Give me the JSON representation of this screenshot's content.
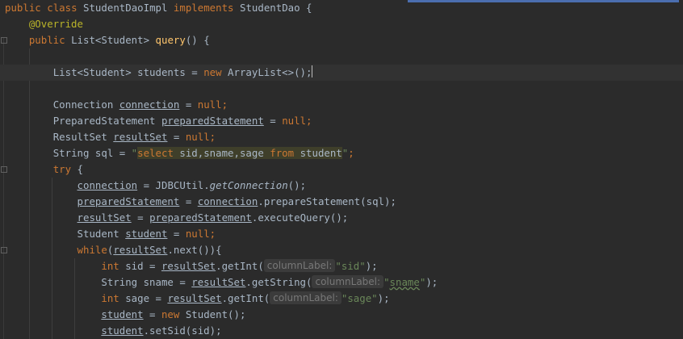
{
  "code": {
    "l1": {
      "kw1": "public",
      "kw2": "class",
      "cls": "StudentDaoImpl",
      "kw3": "implements",
      "iface": "StudentDao {"
    },
    "l2": {
      "ann": "@Override"
    },
    "l3": {
      "kw1": "public",
      "type": "List<Student>",
      "method": "query",
      "rest": "() {"
    },
    "l5": {
      "type": "List<Student> students = ",
      "kw": "new",
      "rest": " ArrayList<>();"
    },
    "l7": {
      "type": "Connection ",
      "var": "connection",
      "eq": " = ",
      "kw": "null",
      "end": ";"
    },
    "l8": {
      "type": "PreparedStatement ",
      "var": "preparedStatement",
      "eq": " = ",
      "kw": "null",
      "end": ";"
    },
    "l9": {
      "type": "ResultSet ",
      "var": "resultSet",
      "eq": " = ",
      "kw": "null",
      "end": ";"
    },
    "l10": {
      "type": "String sql = ",
      "q1": "\"",
      "sql1": "select",
      "sql2": " sid,sname,sage ",
      "sql3": "from",
      "sql4": " student",
      "q2": "\"",
      "end": ";"
    },
    "l11": {
      "kw": "try",
      "rest": " {"
    },
    "l12": {
      "var": "connection",
      "mid": " = JDBCUtil.",
      "call": "getConnection",
      "end": "();"
    },
    "l13": {
      "var": "preparedStatement",
      "mid": " = ",
      "var2": "connection",
      "end": ".prepareStatement(sql);"
    },
    "l14": {
      "var": "resultSet",
      "mid": " = ",
      "var2": "preparedStatement",
      "end": ".executeQuery();"
    },
    "l15": {
      "type": "Student ",
      "var": "student",
      "eq": " = ",
      "kw": "null",
      "end": ";"
    },
    "l16": {
      "kw": "while",
      "open": "(",
      "var": "resultSet",
      "end": ".next()){"
    },
    "l17": {
      "kw": "int",
      "mid": " sid = ",
      "var": "resultSet",
      "call": ".getInt(",
      "hint": "columnLabel:",
      "str": "\"sid\"",
      "end": ");"
    },
    "l18": {
      "type": "String sname = ",
      "var": "resultSet",
      "call": ".getString(",
      "hint": "columnLabel:",
      "q1": "\"",
      "str": "sname",
      "q2": "\"",
      "end": ");"
    },
    "l19": {
      "kw": "int",
      "mid": " sage = ",
      "var": "resultSet",
      "call": ".getInt(",
      "hint": "columnLabel:",
      "str": "\"sage\"",
      "end": ");"
    },
    "l20": {
      "var": "student",
      "eq": " = ",
      "kw": "new",
      "end": " Student();"
    },
    "l21": {
      "var": "student",
      "end": ".setSid(sid);"
    }
  }
}
